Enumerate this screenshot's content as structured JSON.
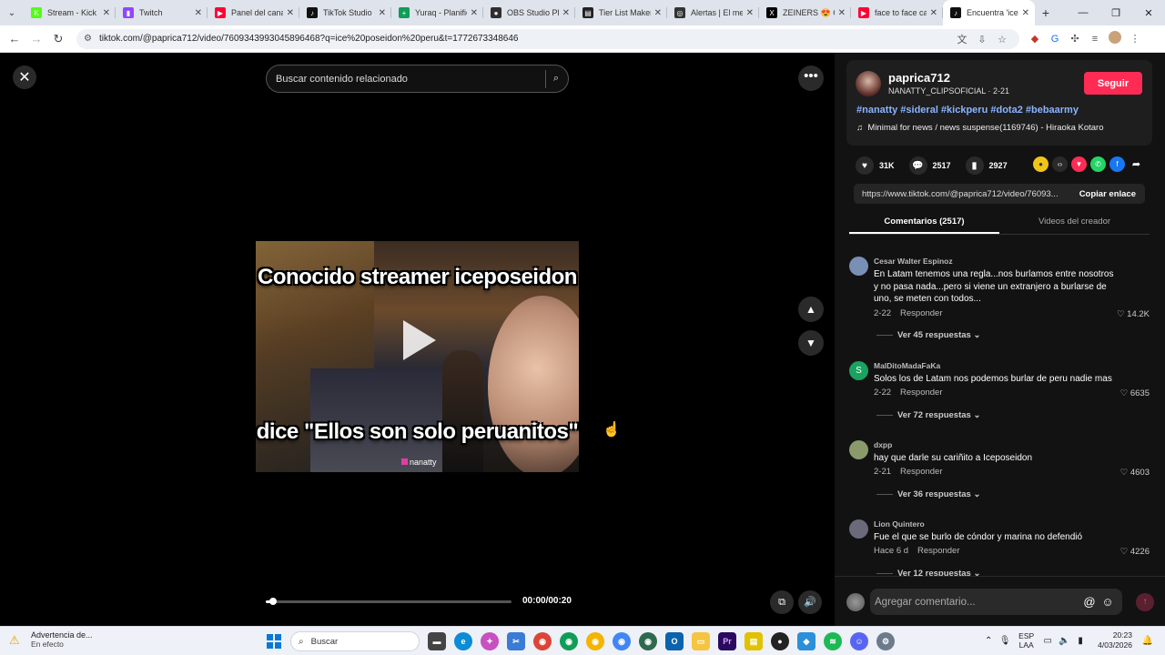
{
  "browser": {
    "tabs": [
      {
        "title": "Stream - Kick D",
        "fav_color": "#53fc18",
        "fav": "K"
      },
      {
        "title": "Twitch",
        "fav_color": "#9146ff",
        "fav": "▮"
      },
      {
        "title": "Panel del canal",
        "fav_color": "#ff0033",
        "fav": "▶"
      },
      {
        "title": "TikTok Studio",
        "fav_color": "#111111",
        "fav": "♪"
      },
      {
        "title": "Yuraq - Planific",
        "fav_color": "#0f9d58",
        "fav": "+"
      },
      {
        "title": "OBS Studio Plu",
        "fav_color": "#302e31",
        "fav": "●"
      },
      {
        "title": "Tier List Maker",
        "fav_color": "#222222",
        "fav": "▤"
      },
      {
        "title": "Alertas | El mej",
        "fav_color": "#333333",
        "fav": "◎"
      },
      {
        "title": "ZEINERS 😍 Co",
        "fav_color": "#000000",
        "fav": "X"
      },
      {
        "title": "face to face ca",
        "fav_color": "#ff0033",
        "fav": "▶"
      },
      {
        "title": "Encuentra 'ice",
        "fav_color": "#111111",
        "fav": "♪",
        "active": true
      }
    ],
    "url": "tiktok.com/@paprica712/video/7609343993045896468?q=ice%20poseidon%20peru&t=1772673348646"
  },
  "video": {
    "search_placeholder": "Buscar contenido relacionado",
    "caption_top": "Conocido streamer iceposeidon",
    "caption_bottom": "dice \"Ellos son solo peruanitos\"",
    "watermark": "nanatty",
    "time": "00:00/00:20",
    "progress_fraction": 0.03
  },
  "panel": {
    "username": "paprica712",
    "subline": "NANATTY_CLIPSOFICIAL · 2-21",
    "follow_label": "Seguir",
    "hashtags": "#nanatty #sideral #kickperu #dota2 #bebaarmy",
    "music": "Minimal for news / news suspense(1169746) - Hiraoka Kotaro",
    "likes": "31K",
    "comments_count": "2517",
    "saves": "2927",
    "link": "https://www.tiktok.com/@paprica712/video/76093...",
    "copy_label": "Copiar enlace",
    "tab_comments": "Comentarios (2517)",
    "tab_videos": "Videos del creador",
    "comment_placeholder": "Agregar comentario...",
    "reply_label": "Responder",
    "comments": [
      {
        "author": "Cesar Walter Espinoz",
        "text": "En Latam tenemos una regla...nos burlamos entre nosotros y no pasa nada...pero si viene un extranjero a burlarse de uno, se meten con todos...",
        "date": "2-22",
        "likes": "14.2K",
        "replies": "Ver 45 respuestas",
        "avatar_color": "#7a8fb5",
        "avatar_letter": ""
      },
      {
        "author": "MalDitoMadaFaKa",
        "text": "Solos los de Latam nos podemos burlar de peru nadie mas",
        "date": "2-22",
        "likes": "6635",
        "replies": "Ver 72 respuestas",
        "avatar_color": "#1aa260",
        "avatar_letter": "S"
      },
      {
        "author": "dxpp",
        "text": "hay que darle su cariñito a Iceposeidon",
        "date": "2-21",
        "likes": "4603",
        "replies": "Ver 36 respuestas",
        "avatar_color": "#8a9a6a",
        "avatar_letter": ""
      },
      {
        "author": "Lion Quintero",
        "text": "Fue el que se burlo de cóndor y marina no defendió",
        "date": "Hace 6 d",
        "likes": "4226",
        "replies": "Ver 12 respuestas",
        "avatar_color": "#6a6a7a",
        "avatar_letter": ""
      }
    ]
  },
  "taskbar": {
    "warning_title": "Advertencia de...",
    "warning_sub": "En efecto",
    "search_label": "Buscar",
    "lang_1": "ESP",
    "lang_2": "LAA",
    "time": "20:23",
    "date": "4/03/2026"
  }
}
